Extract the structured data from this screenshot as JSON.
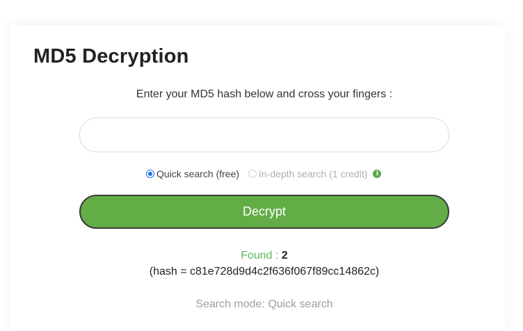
{
  "page": {
    "title": "MD5 Decryption",
    "subtitle": "Enter your MD5 hash below and cross your fingers :"
  },
  "form": {
    "hash_input": {
      "value": "",
      "placeholder": ""
    },
    "options": {
      "quick": {
        "label": "Quick search (free)",
        "selected": true
      },
      "indepth": {
        "label": "In-depth search (1 credit)",
        "selected": false,
        "enabled": false
      },
      "info_icon": "info-icon"
    },
    "decrypt_label": "Decrypt"
  },
  "result": {
    "found_label": "Found :",
    "found_value": "2",
    "hash_text": "(hash = c81e728d9d4c2f636f067f89cc14862c)",
    "mode_text": "Search mode: Quick search"
  },
  "colors": {
    "accent_green": "#63ad47",
    "found_green": "#5cb85c",
    "radio_blue": "#1a73e8"
  }
}
